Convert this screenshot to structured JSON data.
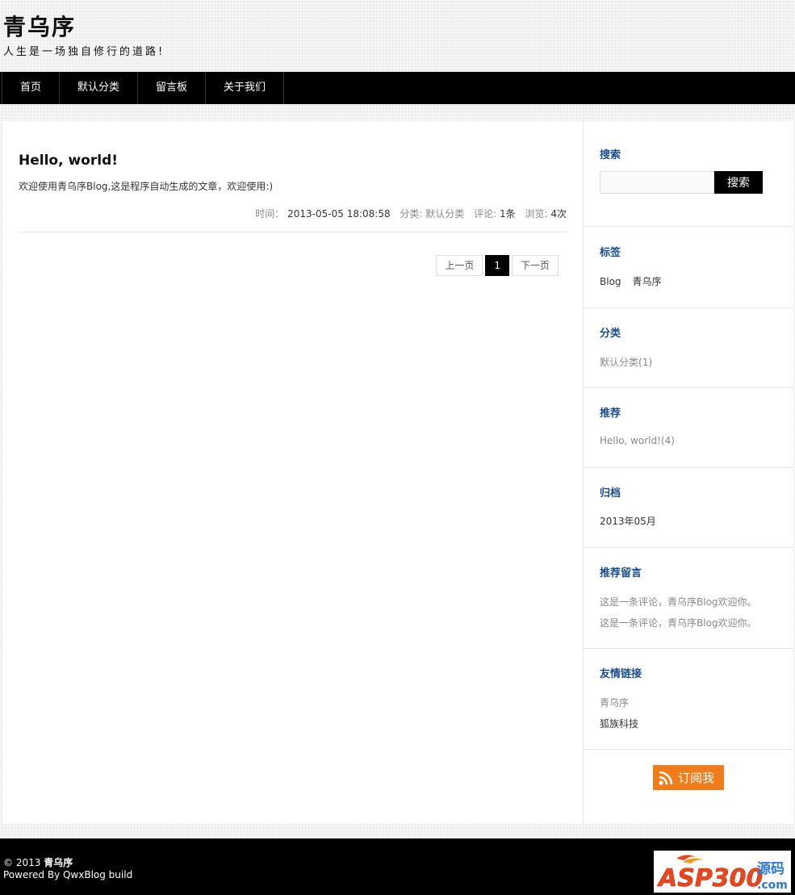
{
  "header": {
    "site_title": "青乌序",
    "tagline": "人生是一场独自修行的道路!"
  },
  "nav": {
    "items": [
      {
        "label": "首页"
      },
      {
        "label": "默认分类"
      },
      {
        "label": "留言板"
      },
      {
        "label": "关于我们"
      }
    ]
  },
  "post": {
    "title": "Hello, world!",
    "excerpt": "欢迎使用青乌序Blog,这是程序自动生成的文章，欢迎使用:)",
    "meta": {
      "time_label": "时间：",
      "time_value": "2013-05-05 18:08:58",
      "category_label": "分类:",
      "category_value": "默认分类",
      "comments_label": "评论:",
      "comments_value": "1条",
      "views_label": "浏览:",
      "views_value": "4次"
    }
  },
  "pagination": {
    "prev": "上一页",
    "current": "1",
    "next": "下一页"
  },
  "sidebar": {
    "search": {
      "title": "搜索",
      "button": "搜索",
      "placeholder": ""
    },
    "tags": {
      "title": "标签",
      "items": [
        "Blog",
        "青乌序"
      ]
    },
    "categories": {
      "title": "分类",
      "item_label": "默认分类",
      "item_count": "(1)"
    },
    "recommended": {
      "title": "推荐",
      "item_label": "Hello, world!",
      "item_count": "(4)"
    },
    "archive": {
      "title": "归档",
      "item": "2013年05月"
    },
    "comments": {
      "title": "推荐留言",
      "items": [
        "这是一条评论，青乌序Blog欢迎你。",
        "这是一条评论，青乌序Blog欢迎你。"
      ]
    },
    "links": {
      "title": "友情链接",
      "items": [
        "青乌序",
        "狐族科技"
      ]
    },
    "rss": {
      "label": "订阅我",
      "icon": "rss-icon"
    }
  },
  "footer": {
    "copyright_prefix": "© 2013",
    "copyright_name": "青乌序",
    "powered": "Powered By QwxBlog build",
    "logo_main": "ASP300",
    "logo_sub": "源码",
    "logo_domain": ".com"
  },
  "colors": {
    "nav_bg": "#000000",
    "widget_title": "#1a4d8f",
    "rss_orange": "#f07d19"
  }
}
